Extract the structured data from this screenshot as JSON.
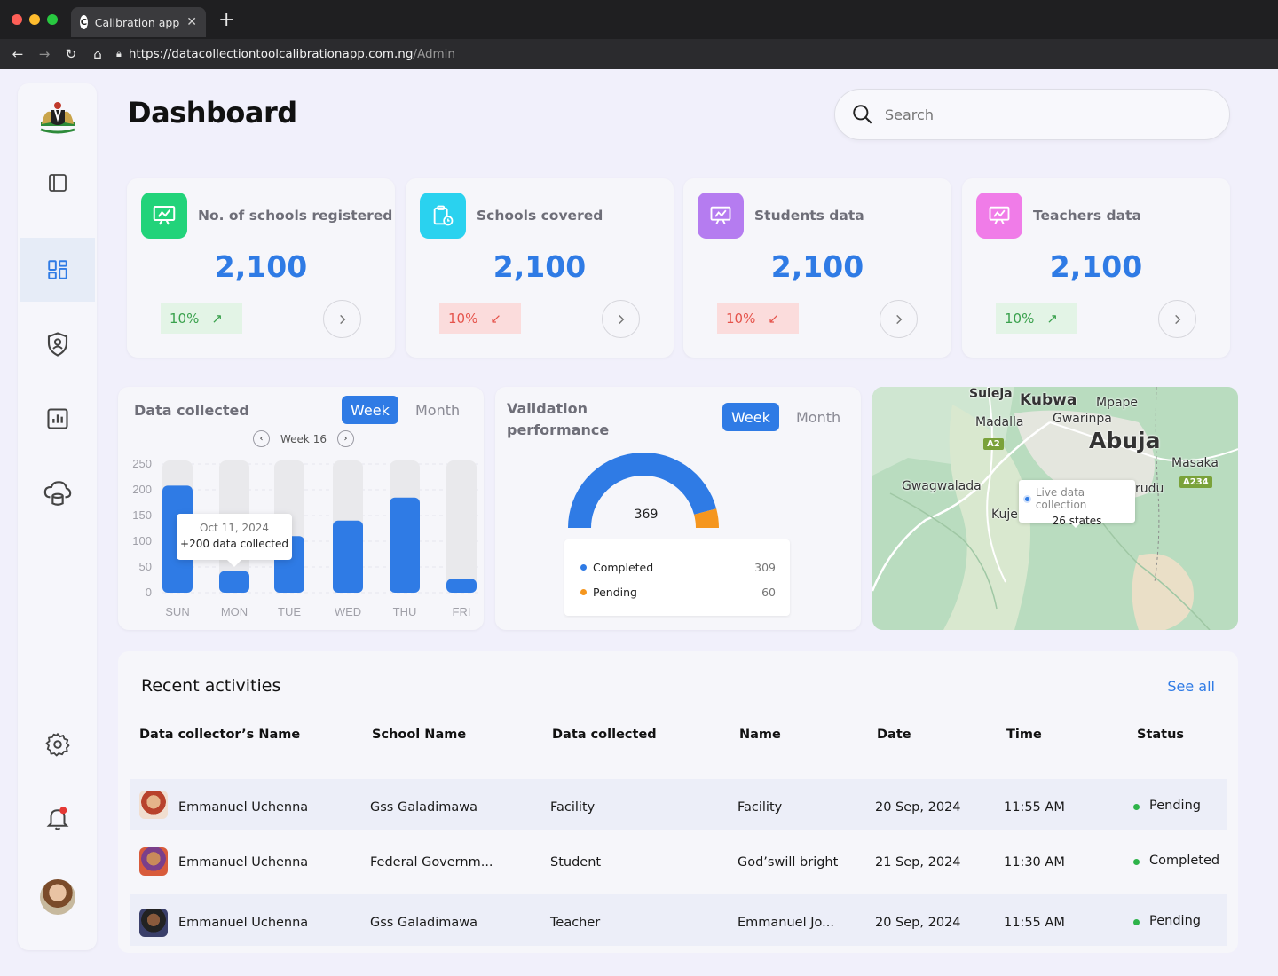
{
  "browser": {
    "tab_title": "Calibration app",
    "tab_favicon": "C",
    "url_host": "https://datacollectiontoolcalibrationapp.com.ng",
    "url_path": "/Admin"
  },
  "page": {
    "title": "Dashboard"
  },
  "search": {
    "placeholder": "Search"
  },
  "stats": [
    {
      "title": "No. of schools registered",
      "value": "2,100",
      "change": "10%",
      "trend": "up",
      "color": "#22d37a"
    },
    {
      "title": "Schools covered",
      "value": "2,100",
      "change": "10%",
      "trend": "down",
      "color": "#2ad2ef"
    },
    {
      "title": "Students data",
      "value": "2,100",
      "change": "10%",
      "trend": "down",
      "color": "#b57cf0"
    },
    {
      "title": "Teachers data",
      "value": "2,100",
      "change": "10%",
      "trend": "up",
      "color": "#f07ce8"
    }
  ],
  "data_collected": {
    "title": "Data collected",
    "tab_week": "Week",
    "tab_month": "Month",
    "week_label": "Week 16",
    "tooltip_date": "Oct 11, 2024",
    "tooltip_text": "+200 data collected"
  },
  "chart_data": {
    "type": "bar",
    "categories": [
      "SUN",
      "MON",
      "TUE",
      "WED",
      "THU",
      "FRI"
    ],
    "values": [
      208,
      42,
      110,
      140,
      185,
      27
    ],
    "yticks": [
      "250",
      "200",
      "150",
      "100",
      "50",
      "0"
    ],
    "ylim": [
      0,
      250
    ],
    "xlabel": "",
    "ylabel": ""
  },
  "validation": {
    "title_line1": "Validation",
    "title_line2": "performance",
    "tab_week": "Week",
    "tab_month": "Month",
    "total": "369",
    "completed_label": "Completed",
    "completed_value": "309",
    "pending_label": "Pending",
    "pending_value": "60",
    "completed_color": "#2f7be5",
    "pending_color": "#f5961e"
  },
  "map": {
    "labels": [
      "Suleja",
      "Kubwa",
      "Mpape",
      "Madalla",
      "Gwarinpa",
      "Abuja",
      "Masaka",
      "Gwagwalada",
      "Kuje",
      "rudu"
    ],
    "tags": [
      "A2",
      "A234"
    ],
    "tip_title": "Live data collection",
    "tip_value": "26 states"
  },
  "activities": {
    "title": "Recent activities",
    "see_all": "See all",
    "headers": [
      "Data collector’s Name",
      "School Name",
      "Data collected",
      "Name",
      "Date",
      "Time",
      "Status"
    ],
    "rows": [
      {
        "collector": "Emmanuel Uchenna",
        "school": "Gss Galadimawa",
        "data": "Facility",
        "name": "Facility",
        "date": "20 Sep, 2024",
        "time": "11:55 AM",
        "status": "Pending"
      },
      {
        "collector": "Emmanuel Uchenna",
        "school": "Federal Governm...",
        "data": "Student",
        "name": "God’swill bright",
        "date": "21 Sep, 2024",
        "time": "11:30 AM",
        "status": "Completed"
      },
      {
        "collector": "Emmanuel Uchenna",
        "school": "Gss Galadimawa",
        "data": "Teacher",
        "name": "Emmanuel Jo...",
        "date": "20 Sep, 2024",
        "time": "11:55 AM",
        "status": "Pending"
      }
    ]
  }
}
